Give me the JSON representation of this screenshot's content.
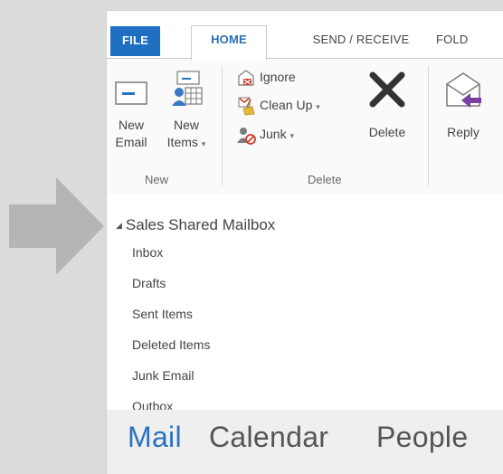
{
  "ribbon_tabs": {
    "file": "FILE",
    "home": "HOME",
    "send_receive": "SEND / RECEIVE",
    "folder": "FOLD"
  },
  "new_group": {
    "new_email_line1": "New",
    "new_email_line2": "Email",
    "new_items_line1": "New",
    "new_items_line2": "Items",
    "label": "New"
  },
  "delete_group": {
    "ignore": "Ignore",
    "clean_up": "Clean Up",
    "junk": "Junk",
    "delete": "Delete",
    "label": "Delete"
  },
  "respond_group": {
    "reply": "Reply"
  },
  "folder_pane": {
    "mailbox_name": "Sales Shared Mailbox",
    "folders": [
      "Inbox",
      "Drafts",
      "Sent Items",
      "Deleted Items",
      "Junk Email",
      "Outbox"
    ]
  },
  "navigation": {
    "mail": "Mail",
    "calendar": "Calendar",
    "people": "People"
  },
  "colors": {
    "accent_blue": "#2a72c0",
    "file_tab_bg": "#1e6fc1",
    "arrow_gray": "#b5b5b5"
  },
  "icons": [
    "pointer-arrow",
    "new-email-icon",
    "new-items-icon",
    "ignore-icon",
    "clean-up-icon",
    "junk-icon",
    "delete-icon",
    "reply-icon",
    "collapse-triangle-icon"
  ]
}
